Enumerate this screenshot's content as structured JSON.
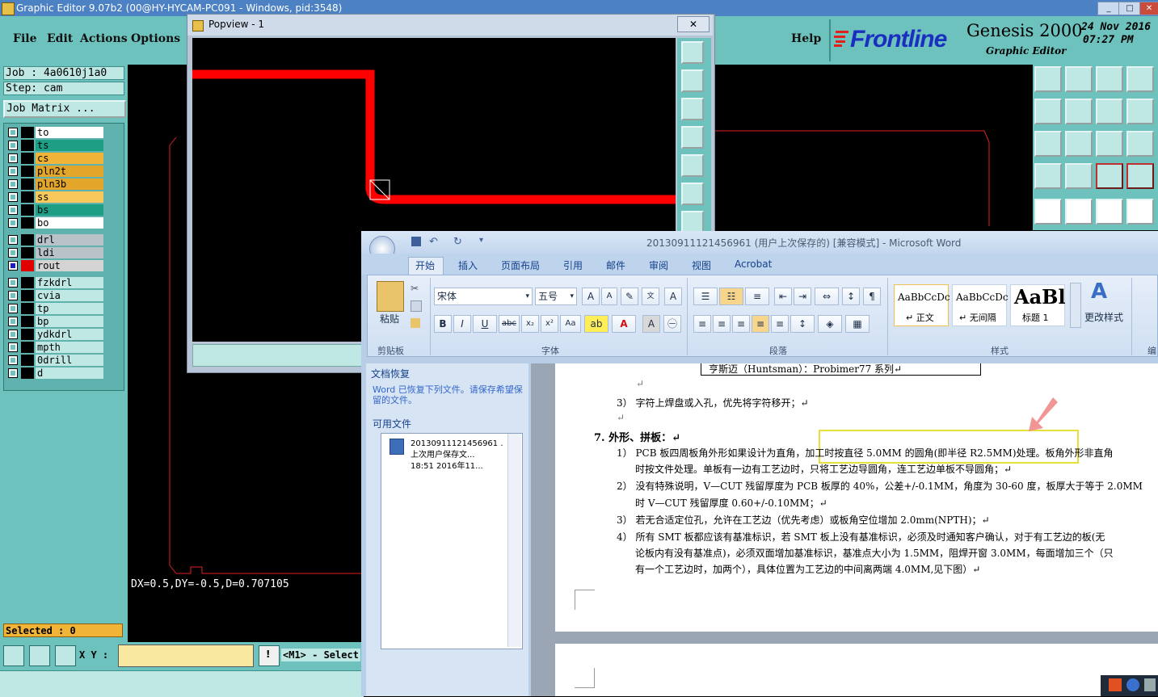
{
  "genesis": {
    "window_title": "Graphic Editor 9.07b2 (00@HY-HYCAM-PC091 - Windows, pid:3548)",
    "menu": [
      "File",
      "Edit",
      "Actions",
      "Options"
    ],
    "help": "Help",
    "brand_logo": "Frontline",
    "product": "Genesis 2000",
    "product_sub": "Graphic Editor",
    "date": "24 Nov 2016",
    "time": "07:27 PM",
    "job": "Job : 4a0610j1a0",
    "step": "Step: cam",
    "job_matrix": "Job Matrix ...",
    "layers": [
      {
        "name": "to",
        "color": "#ffffff"
      },
      {
        "name": "ts",
        "color": "#1f9e86"
      },
      {
        "name": "cs",
        "color": "#f2b437"
      },
      {
        "name": "pln2t",
        "color": "#e3a52a"
      },
      {
        "name": "pln3b",
        "color": "#e3a52a"
      },
      {
        "name": "ss",
        "color": "#f7c85a"
      },
      {
        "name": "bs",
        "color": "#1f9e86"
      },
      {
        "name": "bo",
        "color": "#ffffff"
      },
      {
        "name": "drl",
        "color": "#b9c2c9"
      },
      {
        "name": "ldi",
        "color": "#b9c2c9"
      },
      {
        "name": "rout",
        "color": "#d4d4d4"
      },
      {
        "name": "fzkdrl",
        "color": "#bfe8e4"
      },
      {
        "name": "cvia",
        "color": "#bfe8e4"
      },
      {
        "name": "tp",
        "color": "#bfe8e4"
      },
      {
        "name": "bp",
        "color": "#bfe8e4"
      },
      {
        "name": "ydkdrl",
        "color": "#bfe8e4"
      },
      {
        "name": "mpth",
        "color": "#bfe8e4"
      },
      {
        "name": "0drill",
        "color": "#bfe8e4"
      },
      {
        "name": "d",
        "color": "#bfe8e4"
      }
    ],
    "measurement": "DX=0.5,DY=-0.5,D=0.707105",
    "selected": "Selected : 0",
    "xy_label": "X Y :",
    "mouse_hint": "<M1> - Select"
  },
  "popview": {
    "title": "Popview - 1"
  },
  "word": {
    "title": "20130911121456961 (用户上次保存的) [兼容模式] - Microsoft Word",
    "tabs": [
      "开始",
      "插入",
      "页面布局",
      "引用",
      "邮件",
      "审阅",
      "视图",
      "Acrobat"
    ],
    "font_name": "宋体",
    "font_size": "五号",
    "paste_label": "粘贴",
    "group_labels": [
      "剪贴板",
      "字体",
      "段落",
      "样式"
    ],
    "styles": [
      {
        "preview": "AaBbCcDc",
        "name": "↵ 正文"
      },
      {
        "preview": "AaBbCcDc",
        "name": "↵ 无间隔"
      },
      {
        "preview": "AaBl",
        "name": "标题 1"
      }
    ],
    "change_styles": "更改样式",
    "edit_partial": "编",
    "recover_title": "文档恢复",
    "recover_desc": "Word 已恢复下列文件。请保存希望保留的文件。",
    "available_files": "可用文件",
    "file_item": [
      "20130911121456961 .",
      "上次用户保存文...",
      "18:51 2016年11..."
    ],
    "doc_lines": [
      "亨斯迈（Huntsman）：Probimer77 系列↵",
      "↵",
      "3） 字符上焊盘或入孔，优先将字符移开；↵",
      "↵",
      "7.   外形、拼板：↵",
      "1） PCB 板四周板角外形如果设计为直角，加工时按直径 5.0MM 的圆角(即半径 R2.5MM)处理。板角外形非直角",
      "时按文件处理。单板有一边有工艺边时，只将工艺边导圆角，连工艺边单板不导圆角；↵",
      "2） 没有特殊说明，V—CUT 残留厚度为 PCB 板厚的 40%，公差+/-0.1MM，角度为 30-60 度，板厚大于等于 2.0MM",
      "时 V—CUT 残留厚度 0.60+/-0.10MM；↵",
      "3） 若无合适定位孔，允许在工艺边（优先考虑）或板角空位增加 2.0mm(NPTH)；↵",
      "4） 所有 SMT 板都应该有基准标识，若 SMT 板上没有基准标识，必须及时通知客户确认，对于有工艺边的板(无",
      "论板内有没有基准点)，必须双面增加基准标识，基准点大小为 1.5MM，阻焊开窗 3.0MM，每面增加三个（只",
      "有一个工艺边时，加两个），具体位置为工艺边的中间离两端 4.0MM,见下图）↵"
    ]
  }
}
